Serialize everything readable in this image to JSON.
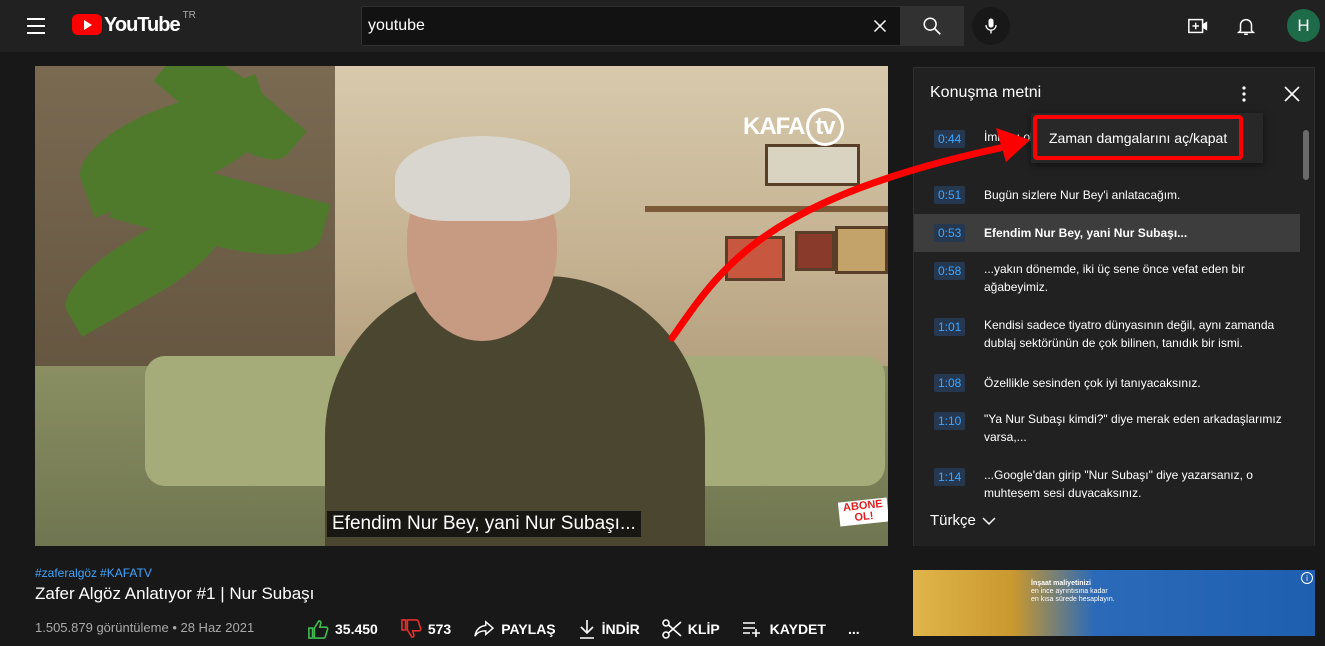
{
  "app": {
    "logo_text": "YouTube",
    "country_code": "TR"
  },
  "search": {
    "value": "youtube"
  },
  "header_icons": [
    "menu-icon",
    "search-icon",
    "mic-icon",
    "create-video-icon",
    "bell-icon"
  ],
  "user": {
    "avatar_letter": "H",
    "avatar_color": "#1e6b4a"
  },
  "player": {
    "channel_logo": "KAFA",
    "channel_logo_tv": "tv",
    "abone_badge": "ABONE OL!",
    "caption": "Efendim Nur Bey, yani Nur Subaşı..."
  },
  "transcript": {
    "title": "Konuşma metni",
    "language": "Türkçe",
    "popup_item": "Zaman damgalarını aç/kapat",
    "rows": [
      {
        "time": "0:44",
        "text": "İmkanı olan da olmayan da kaçırmayın.",
        "active": false
      },
      {
        "time": "0:51",
        "text": "Bugün sizlere Nur Bey'i anlatacağım.",
        "active": false
      },
      {
        "time": "0:53",
        "text": "Efendim Nur Bey, yani Nur Subaşı...",
        "active": true
      },
      {
        "time": "0:58",
        "text": "...yakın dönemde, iki üç sene önce vefat eden bir ağabeyimiz.",
        "active": false
      },
      {
        "time": "1:01",
        "text": "Kendisi sadece tiyatro dünyasının değil, aynı zamanda dublaj sektörünün de çok bilinen, tanıdık bir ismi.",
        "active": false
      },
      {
        "time": "1:08",
        "text": "Özellikle sesinden çok iyi tanıyacaksınız.",
        "active": false
      },
      {
        "time": "1:10",
        "text": "\"Ya Nur Subaşı kimdi?\" diye merak eden arkadaşlarımız varsa,...",
        "active": false
      },
      {
        "time": "1:14",
        "text": "...Google'dan girip \"Nur Subaşı\" diye yazarsanız, o muhteşem sesi duyacaksınız.",
        "active": false
      }
    ]
  },
  "video": {
    "hashtags": [
      "#zaferalgöz",
      "#KAFATV"
    ],
    "title": "Zafer Algöz Anlatıyor #1 | Nur Subaşı",
    "views": "1.505.879 görüntüleme • 28 Haz 2021",
    "likes": "35.450",
    "dislikes": "573",
    "share_label": "PAYLAŞ",
    "download_label": "İNDİR",
    "clip_label": "KLİP",
    "save_label": "KAYDET",
    "more_label": "..."
  },
  "ad": {
    "text_line1": "İnşaat maliyetinizi",
    "text_line2": "en ince ayrıntısına kadar",
    "text_line3": "en kısa sürede hesaplayın.",
    "info": "i"
  },
  "colors": {
    "like_icon": "#3fb950",
    "dislike_icon": "#e0302a",
    "annotation": "#ff0000",
    "timestamp": "#3ea6ff"
  }
}
